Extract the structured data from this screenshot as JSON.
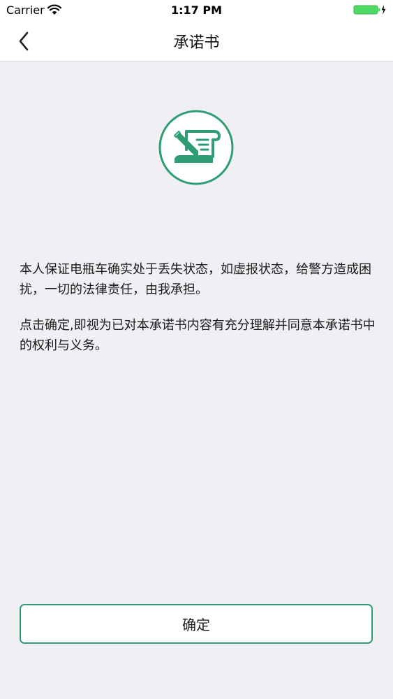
{
  "status_bar": {
    "carrier": "Carrier",
    "time": "1:17 PM"
  },
  "nav": {
    "title": "承诺书"
  },
  "content": {
    "paragraph_1": "本人保证电瓶车确实处于丢失状态，如虚报状态，给警方造成困扰，一切的法律责任，由我承担。",
    "paragraph_2": "点击确定,即视为已对本承诺书内容有充分理解并同意本承诺书中的权利与义务。"
  },
  "actions": {
    "confirm_label": "确定"
  },
  "icons": {
    "back": "chevron-left-icon",
    "pledge": "signing-document-icon",
    "wifi": "wifi-icon",
    "battery": "battery-charging-icon"
  },
  "colors": {
    "accent": "#2e9e72",
    "background": "#efeff4",
    "battery": "#4cd964"
  }
}
